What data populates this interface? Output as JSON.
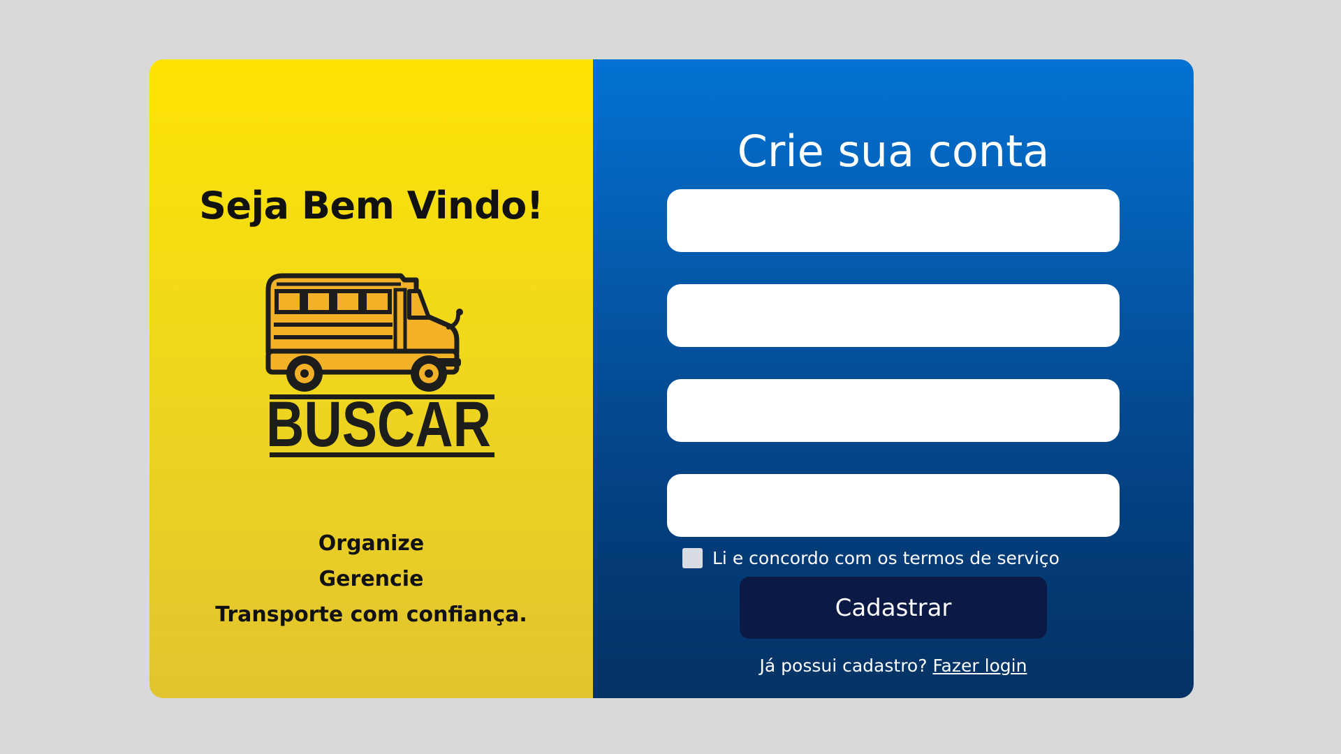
{
  "welcome": {
    "title": "Seja Bem Vindo!",
    "brand": "BUSCAR",
    "tagline": [
      "Organize",
      "Gerencie",
      "Transporte com confiança."
    ]
  },
  "form": {
    "title": "Crie sua conta",
    "fields": [
      {
        "name": "field-1",
        "value": "",
        "placeholder": ""
      },
      {
        "name": "field-2",
        "value": "",
        "placeholder": ""
      },
      {
        "name": "field-3",
        "value": "",
        "placeholder": ""
      },
      {
        "name": "field-4",
        "value": "",
        "placeholder": ""
      }
    ],
    "terms_label": "Li e concordo com os termos de serviço",
    "terms_checked": false,
    "submit_label": "Cadastrar",
    "login_prompt": "Já possui cadastro?",
    "login_link": "Fazer login"
  },
  "colors": {
    "page_background": "#d9d9d9",
    "left_panel": "#fde302",
    "right_panel": "#0458a8",
    "button": "#0b1a45",
    "bus_yellow": "#f2b127",
    "logo_dark": "#1d1d1b"
  },
  "icons": {
    "logo": "school-bus-icon"
  }
}
